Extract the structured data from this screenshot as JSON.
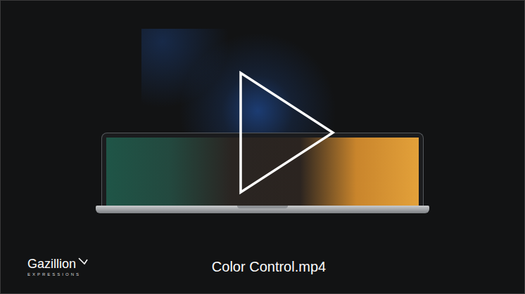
{
  "video": {
    "filename": "Color Control.mp4",
    "playing": false
  },
  "logo": {
    "name": "Gazillion",
    "tagline": "EXPRESSIONS"
  }
}
